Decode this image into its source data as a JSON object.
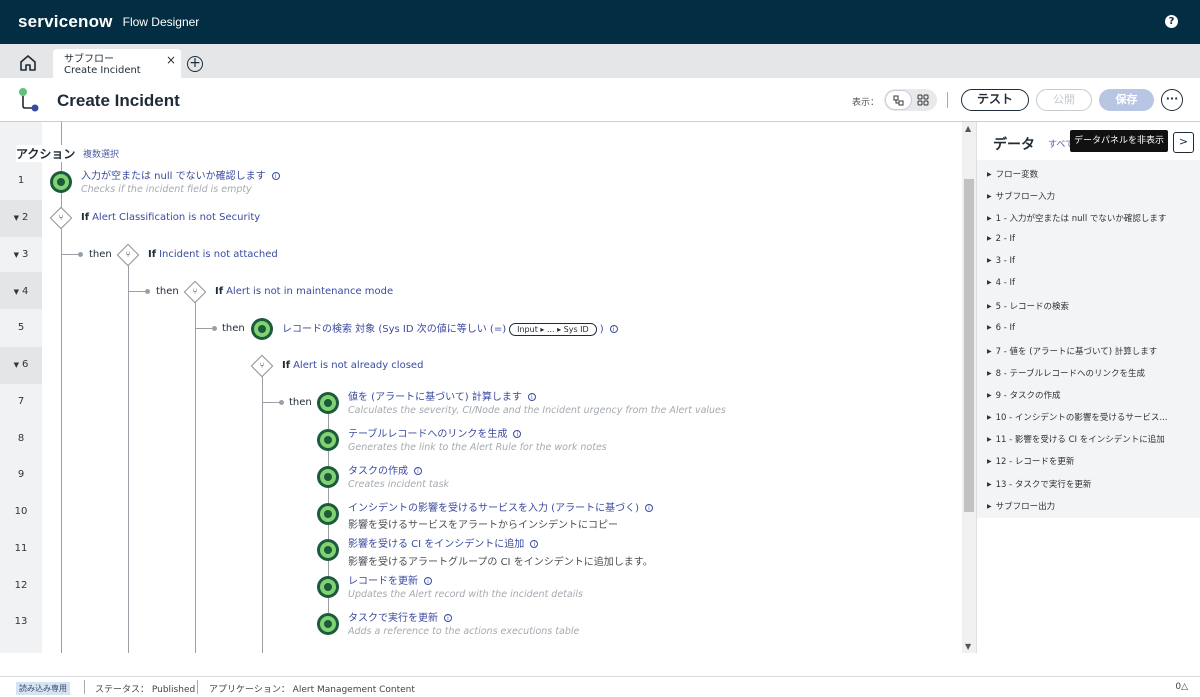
{
  "topbar": {
    "brand": "servicenow",
    "app_name": "Flow Designer",
    "help": "?"
  },
  "tabs": [
    {
      "line1": "サブフロー",
      "line2": "Create Incident",
      "close": "×"
    }
  ],
  "add_tab": "+",
  "header": {
    "title": "Create Incident",
    "display_label": "表示：",
    "test_label": "テスト",
    "publish_label": "公開",
    "save_label": "保存",
    "more_label": "···"
  },
  "canvas": {
    "actions_label": "アクション",
    "multi_select_label": "複数選択",
    "row_numbers": [
      "1",
      "2",
      "3",
      "4",
      "5",
      "6",
      "7",
      "8",
      "9",
      "10",
      "11",
      "12",
      "13"
    ],
    "then_label": "then",
    "if_label": "If",
    "steps": [
      {
        "title": "入力が空または null でないか確認します",
        "desc": "Checks if the incident field is empty"
      },
      {
        "cond": "Alert Classification is not Security"
      },
      {
        "cond": "Incident is not attached"
      },
      {
        "cond": "Alert is not in maintenance mode"
      },
      {
        "title": "レコードの検索 対象 (Sys ID 次の値に等しい (=)",
        "pill": "Input ▸ ... ▸ Sys ID",
        "after": ")"
      },
      {
        "cond": "Alert is not already closed"
      },
      {
        "title": "値を (アラートに基づいて) 計算します",
        "desc": "Calculates the severity, CI/Node and the Incident urgency from the Alert values"
      },
      {
        "title": "テーブルレコードへのリンクを生成",
        "desc": "Generates the link to the Alert Rule for the work notes"
      },
      {
        "title": "タスクの作成",
        "desc": "Creates incident task"
      },
      {
        "title": "インシデントの影響を受けるサービスを入力 (アラートに基づく)",
        "desc": "影響を受けるサービスをアラートからインシデントにコピー"
      },
      {
        "title": "影響を受ける CI をインシデントに追加",
        "desc": "影響を受けるアラートグループの CI をインシデントに追加します。"
      },
      {
        "title": "レコードを更新",
        "desc": "Updates the Alert record with the incident details"
      },
      {
        "title": "タスクで実行を更新",
        "desc": "Adds a reference to the actions executions table"
      }
    ]
  },
  "data_panel": {
    "title": "データ",
    "all_label": "すべて",
    "tooltip": "データパネルを非表示",
    "toggle": ">",
    "items": [
      "フロー変数",
      "サブフロー入力",
      "1 - 入力が空または null でないか確認します",
      "2 - If",
      "3 - If",
      "4 - If",
      "5 - レコードの検索",
      "6 - If",
      "7 - 値を (アラートに基づいて) 計算します",
      "8 - テーブルレコードへのリンクを生成",
      "9 - タスクの作成",
      "10 - インシデントの影響を受けるサービス...",
      "11 - 影響を受ける CI をインシデントに追加",
      "12 - レコードを更新",
      "13 - タスクで実行を更新",
      "サブフロー出力"
    ]
  },
  "statusbar": {
    "readonly": "読み込み専用",
    "status": "ステータス： Published",
    "application": "アプリケーション： Alert Management Content",
    "right": "0△"
  },
  "colors": {
    "topbar": "#032d42",
    "action_node": "#80d273",
    "link": "#3a4aa0"
  }
}
